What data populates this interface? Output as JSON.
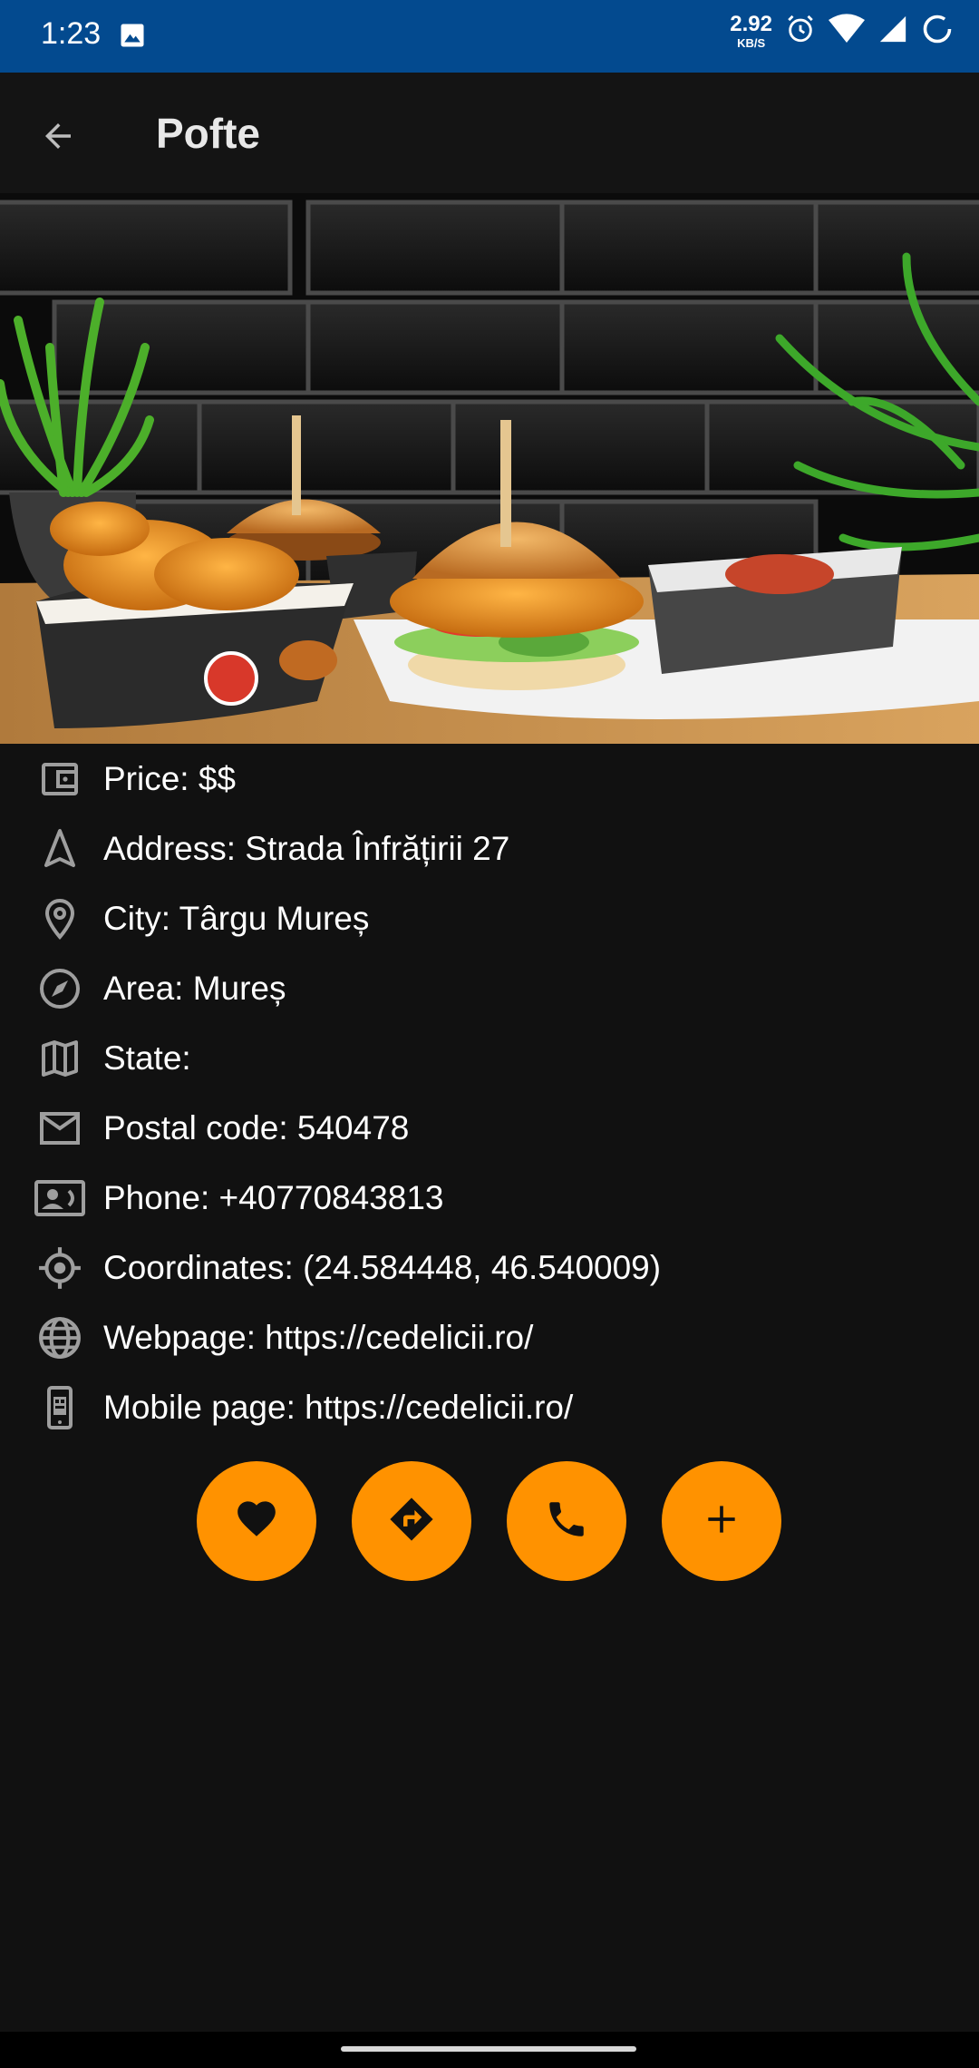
{
  "status_bar": {
    "time": "1:23",
    "net_speed_value": "2.92",
    "net_speed_unit": "KB/S",
    "background": "#034a8f"
  },
  "app_bar": {
    "title": "Pofte"
  },
  "details": [
    {
      "icon": "wallet-icon",
      "text": "Price: $$"
    },
    {
      "icon": "navigation-icon",
      "text": "Address: Strada Înfrățirii 27"
    },
    {
      "icon": "location-pin-icon",
      "text": "City: Târgu Mureș"
    },
    {
      "icon": "compass-icon",
      "text": "Area: Mureș"
    },
    {
      "icon": "map-icon",
      "text": "State:"
    },
    {
      "icon": "mail-icon",
      "text": "Postal code: 540478"
    },
    {
      "icon": "contact-card-icon",
      "text": "Phone: +40770843813"
    },
    {
      "icon": "gps-target-icon",
      "text": "Coordinates: (24.584448, 46.540009)"
    },
    {
      "icon": "globe-icon",
      "text": "Webpage: https://cedelicii.ro/"
    },
    {
      "icon": "mobile-page-icon",
      "text": "Mobile page: https://cedelicii.ro/"
    }
  ],
  "actions": [
    {
      "icon": "heart-icon",
      "name": "favorite"
    },
    {
      "icon": "directions-icon",
      "name": "directions"
    },
    {
      "icon": "phone-icon",
      "name": "call"
    },
    {
      "icon": "plus-icon",
      "name": "add"
    }
  ],
  "colors": {
    "accent": "#ff9200",
    "background": "#111111",
    "icon": "#9e9e9e"
  }
}
